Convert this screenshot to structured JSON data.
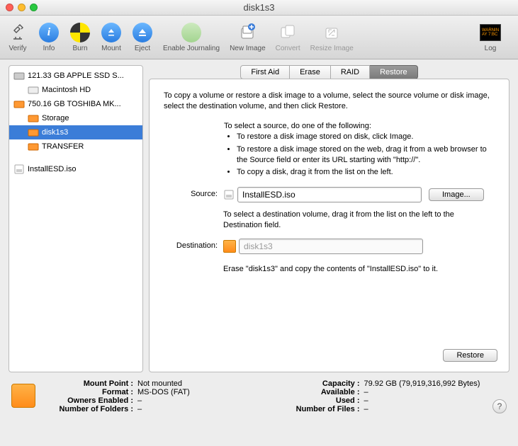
{
  "window": {
    "title": "disk1s3"
  },
  "toolbar": {
    "verify": "Verify",
    "info": "Info",
    "burn": "Burn",
    "mount": "Mount",
    "eject": "Eject",
    "enable_journaling": "Enable Journaling",
    "new_image": "New Image",
    "convert": "Convert",
    "resize_image": "Resize Image",
    "log": "Log"
  },
  "sidebar": {
    "items": [
      {
        "label": "121.33 GB APPLE SSD S..."
      },
      {
        "label": "Macintosh HD"
      },
      {
        "label": "750.16 GB TOSHIBA MK..."
      },
      {
        "label": "Storage"
      },
      {
        "label": "disk1s3"
      },
      {
        "label": "TRANSFER"
      },
      {
        "label": "InstallESD.iso"
      }
    ]
  },
  "tabs": {
    "first_aid": "First Aid",
    "erase": "Erase",
    "raid": "RAID",
    "restore": "Restore"
  },
  "restore": {
    "intro": "To copy a volume or restore a disk image to a volume, select the source volume or disk image, select the destination volume, and then click Restore.",
    "select_source": "To select a source, do one of the following:",
    "bullet1": "To restore a disk image stored on disk, click Image.",
    "bullet2": "To restore a disk image stored on the web, drag it from a web browser to the Source field or enter its URL starting with \"http://\".",
    "bullet3": "To copy a disk, drag it from the list on the left.",
    "source_label": "Source:",
    "source_value": "InstallESD.iso",
    "image_button": "Image...",
    "dest_instructions": "To select a destination volume, drag it from the list on the left to the Destination field.",
    "destination_label": "Destination:",
    "destination_value": "disk1s3",
    "erase_text": "Erase \"disk1s3\" and copy the contents of \"InstallESD.iso\" to it.",
    "restore_button": "Restore"
  },
  "footer": {
    "mount_point_k": "Mount Point :",
    "mount_point_v": "Not mounted",
    "format_k": "Format :",
    "format_v": "MS-DOS (FAT)",
    "owners_k": "Owners Enabled :",
    "owners_v": "–",
    "folders_k": "Number of Folders :",
    "folders_v": "–",
    "capacity_k": "Capacity :",
    "capacity_v": "79.92 GB (79,919,316,992 Bytes)",
    "available_k": "Available :",
    "available_v": "–",
    "used_k": "Used :",
    "used_v": "–",
    "files_k": "Number of Files :",
    "files_v": "–"
  }
}
